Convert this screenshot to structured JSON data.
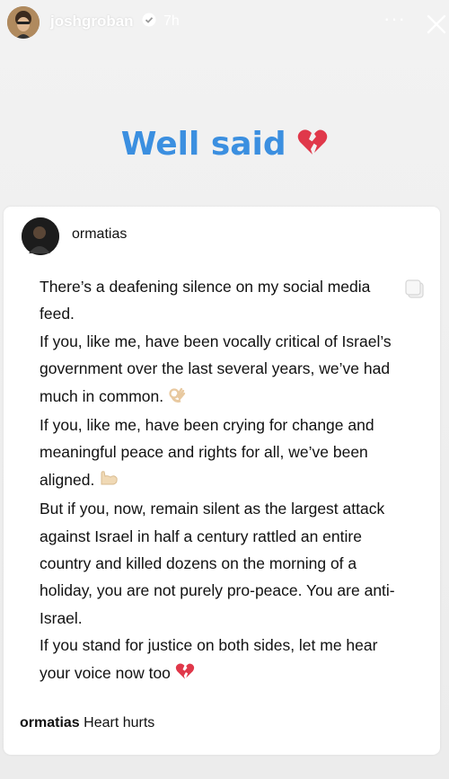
{
  "header": {
    "username": "joshgroban",
    "time": "7h",
    "more": "···"
  },
  "caption": {
    "text": "Well said"
  },
  "post": {
    "username": "ormatias",
    "lines": [
      "There’s a deafening silence on my social media feed.",
      "If you, like me, have been vocally critical of Israel’s government over the last several years, we’ve had much in common.",
      "If you, like me, have been crying for change and meaningful peace and rights for all, we’ve been aligned.",
      "But if you, now, remain silent as the largest attack against Israel in half a century rattled an entire country and killed dozens on the morning of a holiday, you are not purely pro-peace. You are anti-Israel.",
      "If you stand for justice on both sides, let me hear your voice now too"
    ],
    "footer_user": "ormatias",
    "footer_text": "Heart hurts"
  },
  "colors": {
    "caption": "#3b8fe0",
    "heart": "#e0384a",
    "verified": "#3897f0"
  },
  "icons": [
    "verified-badge-icon",
    "close-icon",
    "broken-heart-icon",
    "ok-hand-emoji",
    "flexed-biceps-emoji",
    "copy-icon"
  ]
}
